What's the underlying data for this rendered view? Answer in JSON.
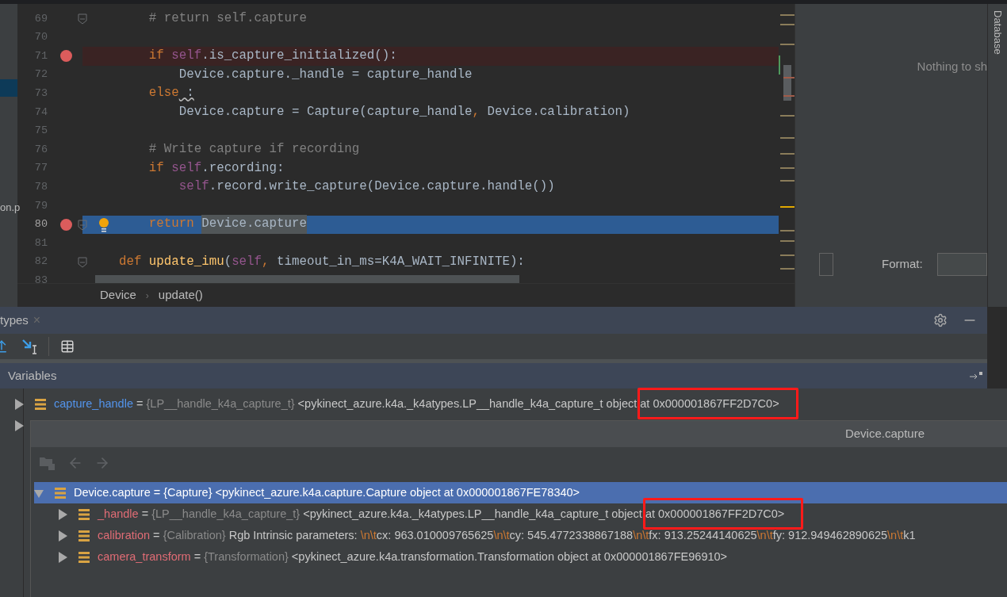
{
  "project_panel": {
    "label": "on.p"
  },
  "editor": {
    "lines": [
      {
        "number": "69",
        "breakpoint": false,
        "kind": "normal",
        "fold": true,
        "intention": false,
        "tokens": [
          {
            "kind": "comment",
            "text": "        # return self.capture"
          }
        ]
      },
      {
        "number": "70",
        "breakpoint": false,
        "kind": "normal",
        "fold": false,
        "intention": false
      },
      {
        "number": "71",
        "breakpoint": true,
        "kind": "breakpoint",
        "fold": false,
        "intention": false,
        "tokens": [
          {
            "kind": "keyword",
            "text": "        if "
          },
          {
            "kind": "self",
            "text": "self"
          },
          {
            "kind": "plain",
            "text": ".is_capture_initialized():"
          }
        ]
      },
      {
        "number": "72",
        "breakpoint": false,
        "kind": "normal",
        "fold": false,
        "intention": false,
        "tokens": [
          {
            "kind": "plain",
            "text": "            Device.capture._handle = capture_handle"
          }
        ]
      },
      {
        "number": "73",
        "breakpoint": false,
        "kind": "normal",
        "fold": false,
        "intention": false,
        "tokens": [
          {
            "kind": "keyword",
            "text": "        else"
          },
          {
            "kind": "warning",
            "text": " :"
          }
        ]
      },
      {
        "number": "74",
        "breakpoint": false,
        "kind": "normal",
        "fold": false,
        "intention": false,
        "tokens": [
          {
            "kind": "plain",
            "text": "            Device.capture = Capture(capture_handle"
          },
          {
            "kind": "keyword",
            "text": ", "
          },
          {
            "kind": "plain",
            "text": "Device.calibration)"
          }
        ]
      },
      {
        "number": "75",
        "breakpoint": false,
        "kind": "normal",
        "fold": false,
        "intention": false
      },
      {
        "number": "76",
        "breakpoint": false,
        "kind": "normal",
        "fold": false,
        "intention": false,
        "tokens": [
          {
            "kind": "comment",
            "text": "        # Write capture if recording"
          }
        ]
      },
      {
        "number": "77",
        "breakpoint": false,
        "kind": "normal",
        "fold": false,
        "intention": false,
        "tokens": [
          {
            "kind": "keyword",
            "text": "        if "
          },
          {
            "kind": "self",
            "text": "self"
          },
          {
            "kind": "plain",
            "text": ".recording:"
          }
        ]
      },
      {
        "number": "78",
        "breakpoint": false,
        "kind": "normal",
        "fold": false,
        "intention": false,
        "tokens": [
          {
            "kind": "self",
            "text": "            self"
          },
          {
            "kind": "plain",
            "text": ".record.write_capture(Device.capture.handle())"
          }
        ]
      },
      {
        "number": "79",
        "breakpoint": false,
        "kind": "normal",
        "fold": false,
        "intention": false
      },
      {
        "number": "80",
        "breakpoint": true,
        "kind": "execution",
        "fold": true,
        "intention": true,
        "tokens": [
          {
            "kind": "keyword",
            "text": "        return "
          },
          {
            "kind": "selection",
            "text": "Device.capture"
          }
        ]
      },
      {
        "number": "81",
        "breakpoint": false,
        "kind": "normal",
        "fold": false,
        "intention": false
      },
      {
        "number": "82",
        "breakpoint": false,
        "kind": "normal",
        "fold": true,
        "intention": false,
        "tokens": [
          {
            "kind": "keyword",
            "text": "    def "
          },
          {
            "kind": "function",
            "text": "update_imu"
          },
          {
            "kind": "plain",
            "text": "("
          },
          {
            "kind": "self",
            "text": "self"
          },
          {
            "kind": "keyword",
            "text": ", "
          },
          {
            "kind": "plain",
            "text": "timeout_in_ms=K4A_WAIT_INFINITE):"
          }
        ]
      },
      {
        "number": "83",
        "breakpoint": false,
        "kind": "normal",
        "fold": false,
        "intention": false
      }
    ],
    "breadcrumbs": [
      "Device",
      "update()"
    ],
    "breadcrumb_separator": "›"
  },
  "side_panel": {
    "message": "Nothing to sh",
    "checkbox_checked": false,
    "format_label": "Format:"
  },
  "tool_strip": {
    "label": "Database"
  },
  "debug": {
    "tab": {
      "label": "types",
      "close": "×"
    },
    "variables_title": "Variables",
    "variables": [
      {
        "name": "capture_handle",
        "color": "#5394ec",
        "operator": "=",
        "type": "{LP__handle_k4a_capture_t}",
        "expanded": false,
        "value": [
          {
            "kind": "text",
            "text": " <pykinect_azure.k4a._k4atypes.LP__handle_k4a_capture_t object"
          },
          {
            "kind": "marked",
            "text": " at 0x000001867FF2D7C0>"
          }
        ]
      },
      {
        "expanded": false
      }
    ]
  },
  "popup": {
    "title": "Device.capture",
    "root": {
      "name": "Device.capture",
      "operator": "=",
      "type": "{Capture}",
      "selected": true,
      "expanded": true,
      "value": [
        {
          "kind": "text",
          "text": " <pykinect_azure.k4a.capture.Capture object at 0x000001867FE78340>"
        }
      ],
      "children": [
        {
          "name": "_handle",
          "color": "#e06c75",
          "operator": "=",
          "type": "{LP__handle_k4a_capture_t}",
          "selected": false,
          "expanded": false,
          "value": [
            {
              "kind": "text",
              "text": " <pykinect_azure.k4a._k4atypes.LP__handle_k4a_capture_t object"
            },
            {
              "kind": "marked",
              "text": " at 0x000001867FF2D7C0>"
            }
          ]
        },
        {
          "name": "calibration",
          "color": "#e06c75",
          "operator": "=",
          "type": "{Calibration}",
          "selected": false,
          "expanded": false,
          "value": [
            {
              "kind": "text",
              "text": " Rgb Intrinsic parameters: "
            },
            {
              "kind": "escape",
              "text": "\\n\\t"
            },
            {
              "kind": "text",
              "text": "cx: 963.010009765625"
            },
            {
              "kind": "escape",
              "text": "\\n\\t"
            },
            {
              "kind": "text",
              "text": "cy: 545.4772338867188"
            },
            {
              "kind": "escape",
              "text": "\\n\\t"
            },
            {
              "kind": "text",
              "text": "fx: 913.25244140625"
            },
            {
              "kind": "escape",
              "text": "\\n\\t"
            },
            {
              "kind": "text",
              "text": "fy: 912.949462890625"
            },
            {
              "kind": "escape",
              "text": "\\n\\t"
            },
            {
              "kind": "text",
              "text": "k1"
            }
          ]
        },
        {
          "name": "camera_transform",
          "color": "#e06c75",
          "operator": "=",
          "type": "{Transformation}",
          "selected": false,
          "expanded": false,
          "value": [
            {
              "kind": "text",
              "text": " <pykinect_azure.k4a.transformation.Transformation object at 0x000001867FE96910>"
            }
          ]
        }
      ]
    }
  }
}
